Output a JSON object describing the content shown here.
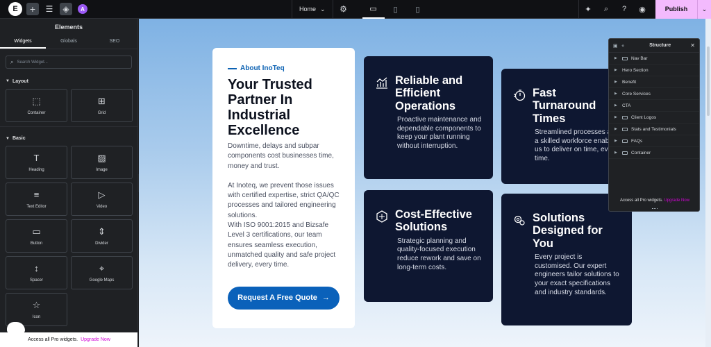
{
  "topbar": {
    "logo": "E",
    "page_name": "Home",
    "publish_label": "Publish"
  },
  "panel": {
    "title": "Elements",
    "tabs": [
      {
        "label": "Widgets"
      },
      {
        "label": "Globals"
      },
      {
        "label": "SEO"
      }
    ],
    "search_placeholder": "Search Widget...",
    "layout_label": "Layout",
    "basic_label": "Basic",
    "layout_widgets": [
      {
        "label": "Container",
        "icon": "container-icon"
      },
      {
        "label": "Grid",
        "icon": "grid-icon"
      }
    ],
    "basic_widgets": [
      {
        "label": "Heading",
        "icon": "heading-icon"
      },
      {
        "label": "Image",
        "icon": "image-icon"
      },
      {
        "label": "Text Editor",
        "icon": "text-editor-icon"
      },
      {
        "label": "Video",
        "icon": "video-icon"
      },
      {
        "label": "Button",
        "icon": "button-icon"
      },
      {
        "label": "Divider",
        "icon": "divider-icon"
      },
      {
        "label": "Spacer",
        "icon": "spacer-icon"
      },
      {
        "label": "Google Maps",
        "icon": "map-icon"
      },
      {
        "label": "Icon",
        "icon": "star-icon"
      }
    ],
    "promo_text": "Access all Pro widgets.",
    "promo_link": "Upgrade Now"
  },
  "about": {
    "eyebrow": "About InoTeq",
    "title": "Your Trusted Partner In Industrial Excellence",
    "p1": "Downtime, delays and subpar components cost businesses time, money and trust.",
    "p2": "At Inoteq, we prevent those issues with certified expertise, strict QA/QC processes and tailored engineering solutions.",
    "p3": "With ISO 9001:2015 and Bizsafe Level 3 certifications, our team ensures seamless execution, unmatched quality and safe project delivery, every time.",
    "cta": "Request A Free Quote",
    "cta_arrow": "→"
  },
  "cards": [
    {
      "title": "Reliable and Efficient Operations",
      "text": "Proactive maintenance and dependable components to keep your plant running without interruption.",
      "icon": "chart-icon"
    },
    {
      "title": "Fast Turnaround Times",
      "text": "Streamlined processes and a skilled workforce enable us to deliver on time, every time.",
      "icon": "stopwatch-icon"
    },
    {
      "title": "Cost-Effective Solutions",
      "text": "Strategic planning and quality-focused execution reduce rework and save on long-term costs.",
      "icon": "hexagon-icon"
    },
    {
      "title": "Solutions Designed for You",
      "text": "Every project is customised. Our expert engineers tailor solutions to your exact specifications and industry standards.",
      "icon": "gears-icon"
    }
  ],
  "structure": {
    "title": "Structure",
    "items": [
      {
        "label": "Nav Bar"
      },
      {
        "label": "Hero Section"
      },
      {
        "label": "Benefit"
      },
      {
        "label": "Core Services"
      },
      {
        "label": "CTA"
      },
      {
        "label": "Client Logos"
      },
      {
        "label": "Stats and Testimonials"
      },
      {
        "label": "FAQs"
      },
      {
        "label": "Container"
      }
    ],
    "footer_text": "Access all Pro widgets.",
    "footer_link": "Upgrade Now"
  },
  "colors": {
    "publish": "#f3bafd",
    "brand_blue": "#0a61ba",
    "card_bg": "#0e1731",
    "upgrade_link": "#d004d4"
  }
}
